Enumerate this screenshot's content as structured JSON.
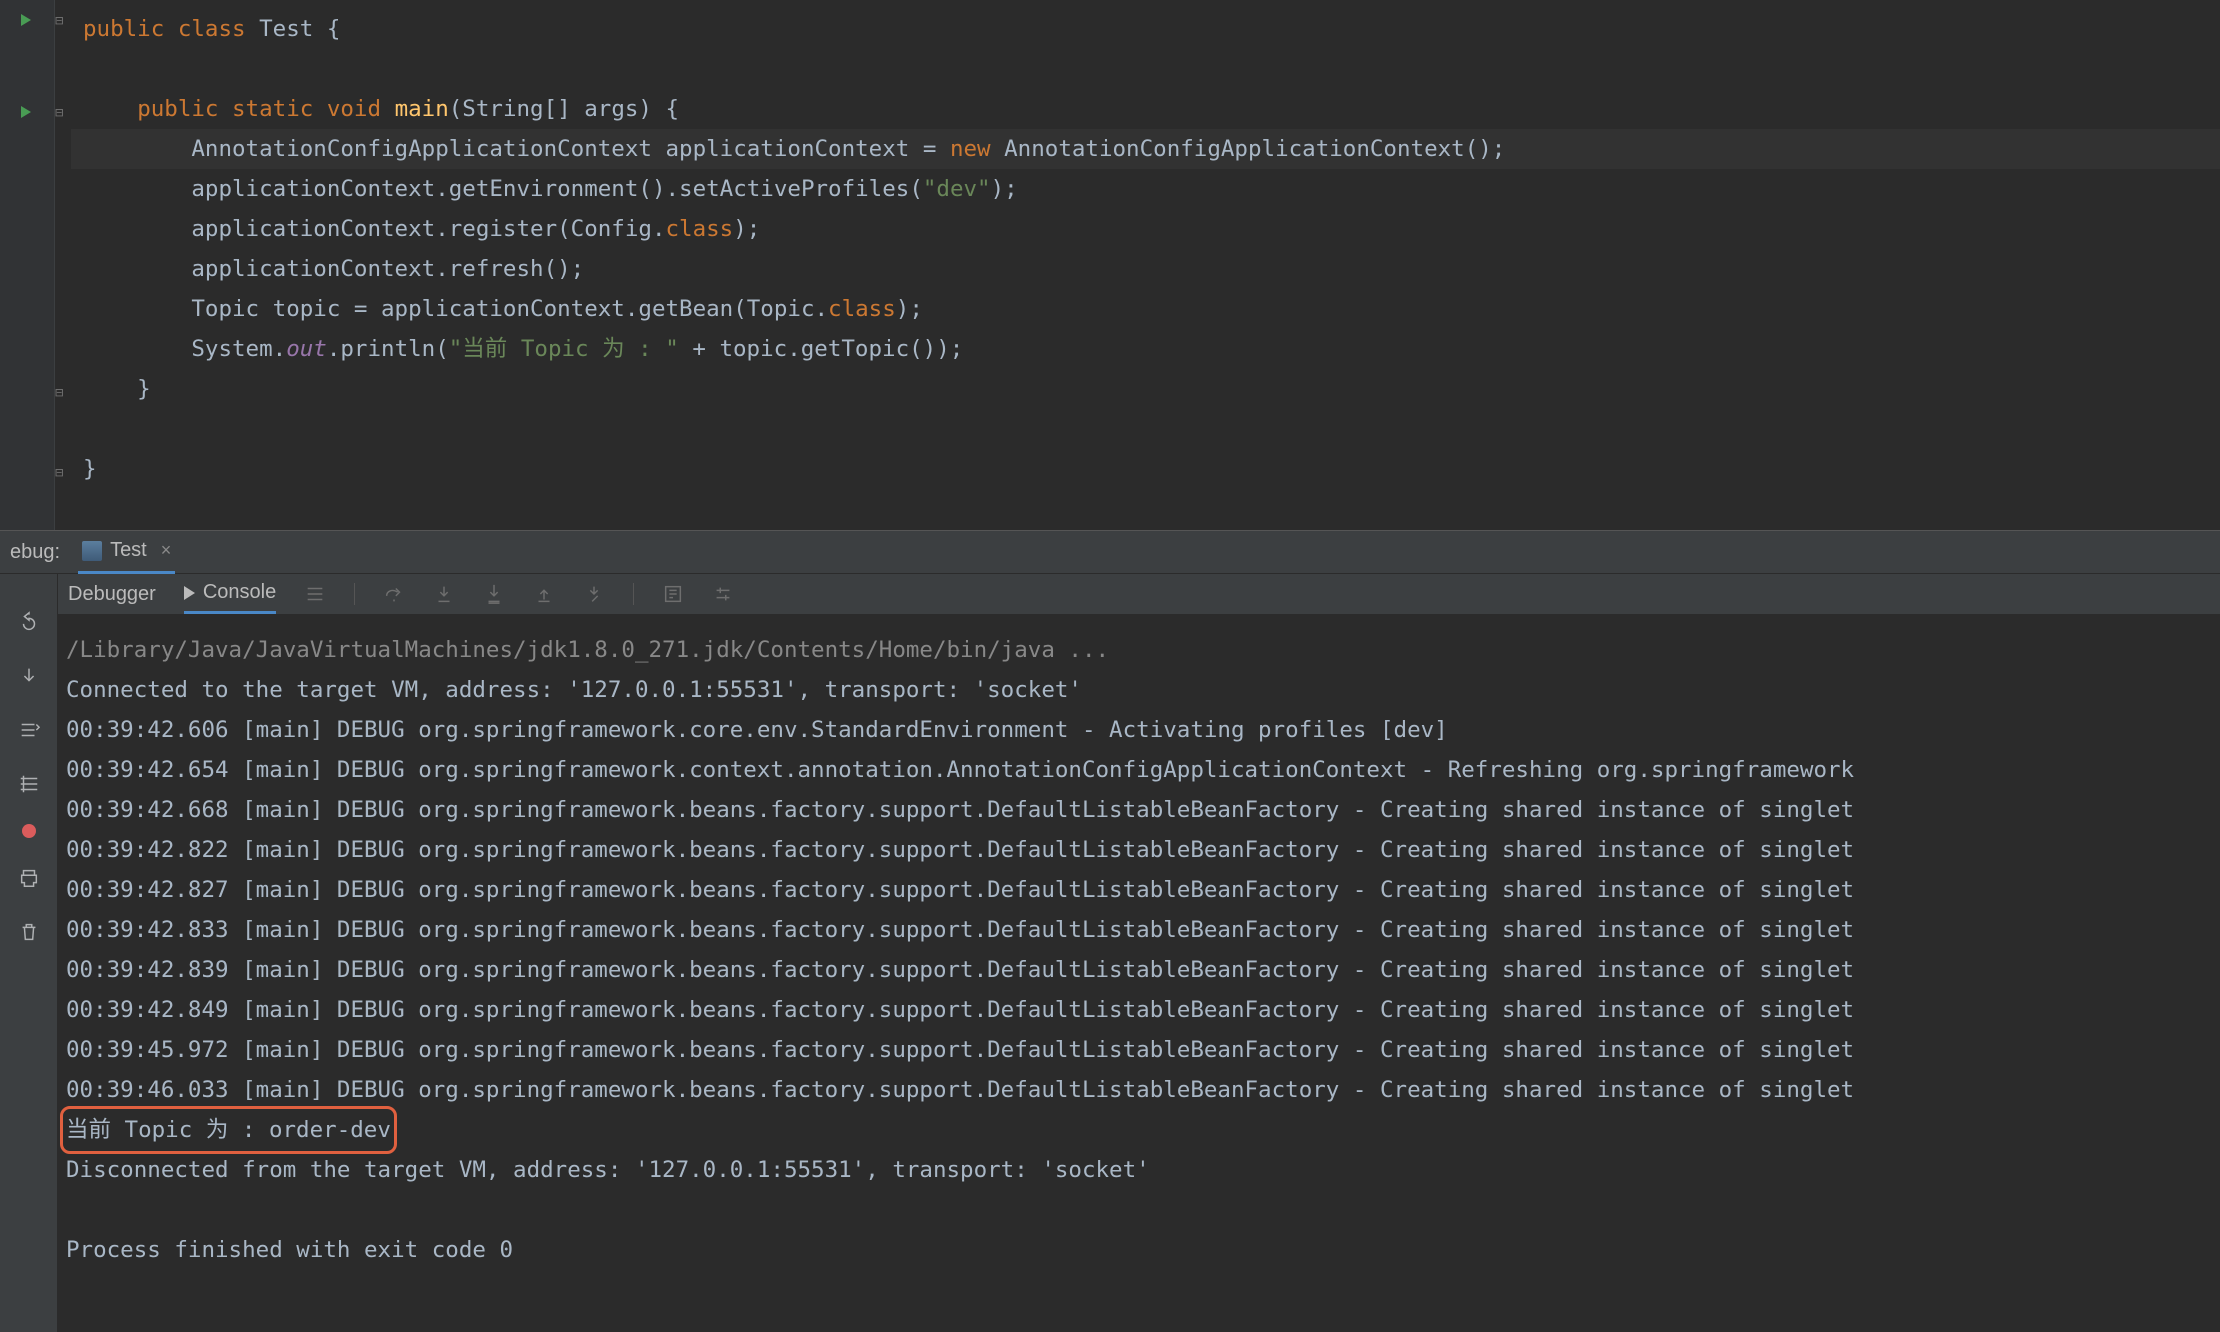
{
  "debug_header": {
    "label": "ebug:",
    "run_config": "Test"
  },
  "tabs": {
    "debugger": "Debugger",
    "console": "Console"
  },
  "code": {
    "lines": [
      [
        [
          "kw",
          "public "
        ],
        [
          "kw",
          "class "
        ],
        [
          "id",
          "Test {"
        ]
      ],
      [
        [
          "",
          ""
        ]
      ],
      [
        [
          "id",
          "    "
        ],
        [
          "kw",
          "public "
        ],
        [
          "kw",
          "static "
        ],
        [
          "kw",
          "void "
        ],
        [
          "fn",
          "main"
        ],
        [
          "id",
          "(String[] args) {"
        ]
      ],
      [
        [
          "id",
          "        AnnotationConfigApplicationContext applicationContext = "
        ],
        [
          "kw",
          "new "
        ],
        [
          "id",
          "AnnotationConfigApplicationContext();"
        ]
      ],
      [
        [
          "id",
          "        applicationContext.getEnvironment().setActiveProfiles("
        ],
        [
          "str",
          "\"dev\""
        ],
        [
          "id",
          ");"
        ]
      ],
      [
        [
          "id",
          "        applicationContext.register(Config."
        ],
        [
          "kw",
          "class"
        ],
        [
          "id",
          ");"
        ]
      ],
      [
        [
          "id",
          "        applicationContext.refresh();"
        ]
      ],
      [
        [
          "id",
          "        Topic topic = applicationContext.getBean(Topic."
        ],
        [
          "kw",
          "class"
        ],
        [
          "id",
          ");"
        ]
      ],
      [
        [
          "id",
          "        System."
        ],
        [
          "it",
          "out"
        ],
        [
          "id",
          ".println("
        ],
        [
          "str",
          "\"当前 Topic 为 : \""
        ],
        [
          "id",
          " + topic.getTopic());"
        ]
      ],
      [
        [
          "id",
          "    }"
        ]
      ],
      [
        [
          "",
          ""
        ]
      ],
      [
        [
          "id",
          "}"
        ]
      ]
    ],
    "highlight_index": 3
  },
  "console": {
    "java_cmd": "/Library/Java/JavaVirtualMachines/jdk1.8.0_271.jdk/Contents/Home/bin/java ...",
    "lines": [
      "Connected to the target VM, address: '127.0.0.1:55531', transport: 'socket'",
      "00:39:42.606 [main] DEBUG org.springframework.core.env.StandardEnvironment - Activating profiles [dev]",
      "00:39:42.654 [main] DEBUG org.springframework.context.annotation.AnnotationConfigApplicationContext - Refreshing org.springframework",
      "00:39:42.668 [main] DEBUG org.springframework.beans.factory.support.DefaultListableBeanFactory - Creating shared instance of singlet",
      "00:39:42.822 [main] DEBUG org.springframework.beans.factory.support.DefaultListableBeanFactory - Creating shared instance of singlet",
      "00:39:42.827 [main] DEBUG org.springframework.beans.factory.support.DefaultListableBeanFactory - Creating shared instance of singlet",
      "00:39:42.833 [main] DEBUG org.springframework.beans.factory.support.DefaultListableBeanFactory - Creating shared instance of singlet",
      "00:39:42.839 [main] DEBUG org.springframework.beans.factory.support.DefaultListableBeanFactory - Creating shared instance of singlet",
      "00:39:42.849 [main] DEBUG org.springframework.beans.factory.support.DefaultListableBeanFactory - Creating shared instance of singlet",
      "00:39:45.972 [main] DEBUG org.springframework.beans.factory.support.DefaultListableBeanFactory - Creating shared instance of singlet",
      "00:39:46.033 [main] DEBUG org.springframework.beans.factory.support.DefaultListableBeanFactory - Creating shared instance of singlet"
    ],
    "highlight_line": "当前 Topic 为 : order-dev",
    "disconnect": "Disconnected from the target VM, address: '127.0.0.1:55531', transport: 'socket'",
    "exit": "Process finished with exit code 0"
  }
}
